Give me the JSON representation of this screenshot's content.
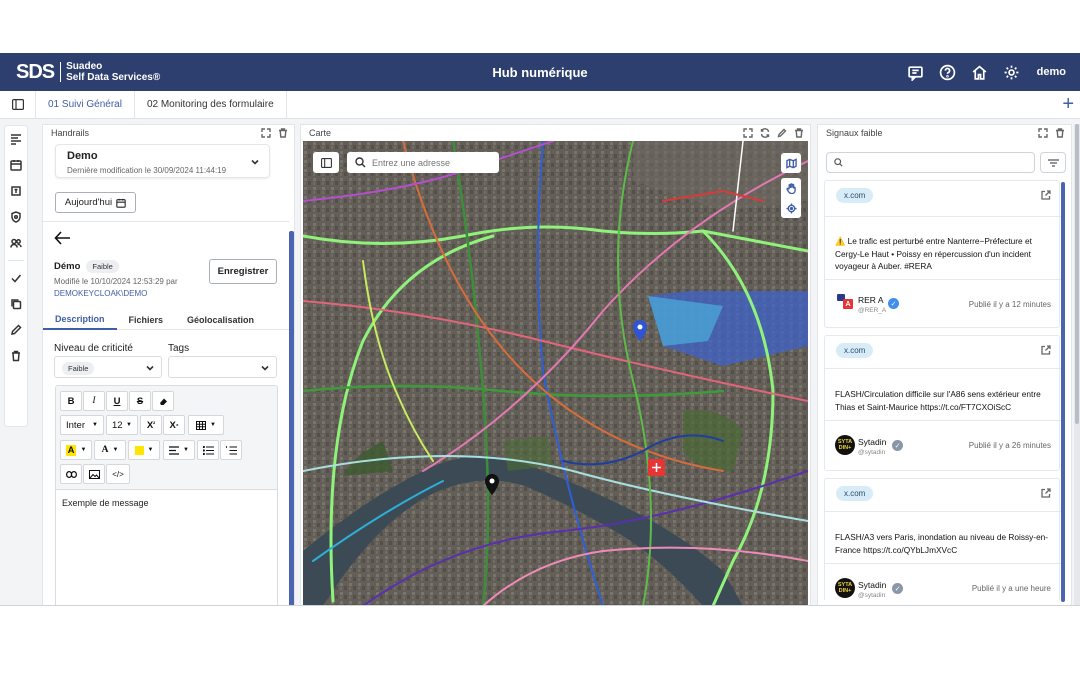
{
  "header": {
    "logo_mark": "SDS",
    "logo_line1": "Suadeo",
    "logo_line2": "Self Data Services®",
    "title": "Hub numérique",
    "user": "demo",
    "icons": [
      "chat-icon",
      "help-icon",
      "home-icon",
      "settings-icon"
    ]
  },
  "tabs": [
    {
      "label": "01 Suivi Général",
      "active": true
    },
    {
      "label": "02 Monitoring des formulaire",
      "active": false
    }
  ],
  "handrails": {
    "panel_title": "Handrails",
    "select_title": "Demo",
    "select_subtitle": "Dernière modification le 30/09/2024 11:44:19",
    "today_button": "Aujourd'hui",
    "item_title": "Démo",
    "item_badge": "Faible",
    "modified": "Modifié le 10/10/2024 12:53:29 par",
    "modified_by": "DEMOKEYCLOAK\\DEMO",
    "save_button": "Enregistrer",
    "subtabs": [
      "Description",
      "Fichiers",
      "Géolocalisation"
    ],
    "criticity_label": "Niveau de criticité",
    "criticity_value": "Faible",
    "tags_label": "Tags",
    "editor": {
      "font": "Inter",
      "size": "12",
      "text": "Exemple de message"
    }
  },
  "map": {
    "panel_title": "Carte",
    "search_placeholder": "Entrez une adresse"
  },
  "signals": {
    "panel_title": "Signaux faible",
    "items": [
      {
        "source": "x.com",
        "text": "⚠️ Le trafic est perturbé entre Nanterre−Préfecture et Cergy-Le Haut • Poissy en répercussion d'un incident voyageur à Auber. #RERA",
        "account": "RER A",
        "handle": "@RER_A",
        "published": "Publié il y a 12 minutes"
      },
      {
        "source": "x.com",
        "text": "FLASH/Circulation difficile sur l'A86 sens extérieur entre Thias et Saint-Maurice https://t.co/FT7CXOiScC",
        "account": "Sytadin",
        "handle": "@sytadin",
        "published": "Publié il y a 26 minutes"
      },
      {
        "source": "x.com",
        "text": "FLASH/A3 vers Paris, inondation au niveau de Roissy-en-France https://t.co/QYbLJmXVcC",
        "account": "Sytadin",
        "handle": "@sytadin",
        "published": "Publié il y a une heure"
      }
    ]
  },
  "colors": {
    "brand": "#2d3f6e",
    "accent": "#3f5ea8"
  }
}
